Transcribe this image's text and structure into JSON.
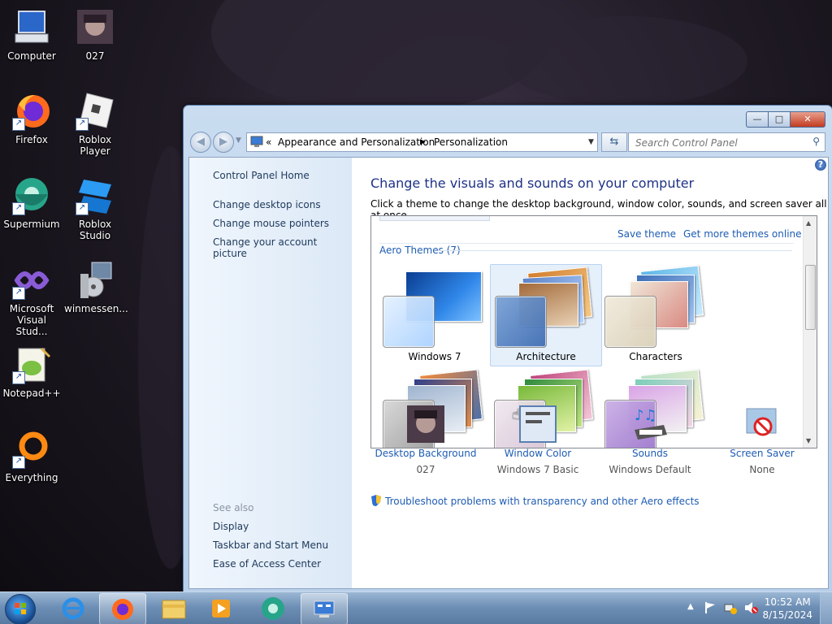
{
  "desktop_icons": [
    {
      "label": "Computer",
      "icon": "computer-icon"
    },
    {
      "label": "027",
      "icon": "image-icon"
    },
    {
      "label": "Firefox",
      "icon": "firefox-icon"
    },
    {
      "label": "Roblox Player",
      "icon": "roblox-icon"
    },
    {
      "label": "Supermium",
      "icon": "supermium-icon"
    },
    {
      "label": "Roblox Studio",
      "icon": "roblox-studio-icon"
    },
    {
      "label": "Microsoft Visual Stud...",
      "icon": "visual-studio-icon"
    },
    {
      "label": "winmessen...",
      "icon": "installer-icon"
    },
    {
      "label": "Notepad++",
      "icon": "notepadpp-icon"
    },
    {
      "label": "Everything",
      "icon": "everything-icon"
    }
  ],
  "window": {
    "breadcrumb": {
      "prefix": "«",
      "parts": [
        "Appearance and Personalization",
        "Personalization"
      ]
    },
    "search_placeholder": "Search Control Panel"
  },
  "left_pane": {
    "links": [
      "Control Panel Home",
      "Change desktop icons",
      "Change mouse pointers",
      "Change your account picture"
    ],
    "see_also_title": "See also",
    "see_also": [
      "Display",
      "Taskbar and Start Menu",
      "Ease of Access Center"
    ]
  },
  "main": {
    "heading": "Change the visuals and sounds on your computer",
    "subheading": "Click a theme to change the desktop background, window color, sounds, and screen saver all at once.",
    "save_theme": "Save theme",
    "get_more": "Get more themes online",
    "group_label": "Aero Themes (7)",
    "themes": [
      {
        "name": "Windows 7",
        "selected": false
      },
      {
        "name": "Architecture",
        "selected": true
      },
      {
        "name": "Characters",
        "selected": false
      },
      {
        "name": "",
        "selected": false
      },
      {
        "name": "",
        "selected": false
      },
      {
        "name": "",
        "selected": false
      }
    ],
    "bottom": [
      {
        "title": "Desktop Background",
        "value": "027"
      },
      {
        "title": "Window Color",
        "value": "Windows 7 Basic"
      },
      {
        "title": "Sounds",
        "value": "Windows Default"
      },
      {
        "title": "Screen Saver",
        "value": "None"
      }
    ],
    "troubleshoot": "Troubleshoot problems with transparency and other Aero effects"
  },
  "taskbar": {
    "time": "10:52 AM",
    "date": "8/15/2024"
  }
}
